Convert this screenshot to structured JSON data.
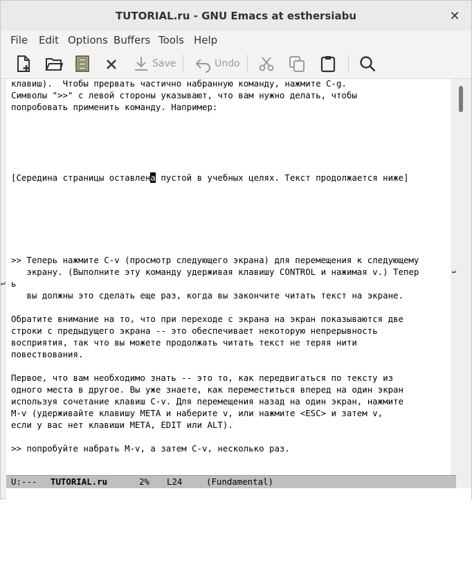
{
  "window": {
    "title": "TUTORIAL.ru - GNU Emacs at esthersiabu",
    "close_glyph": "✕"
  },
  "menubar": [
    "File",
    "Edit",
    "Options",
    "Buffers",
    "Tools",
    "Help"
  ],
  "toolbar": {
    "save_label": "Save",
    "undo_label": "Undo"
  },
  "buffer": {
    "lines": [
      "клавиш).  Чтобы прервать частично набранную команду, нажмите C-g.",
      "Символы \">>\" с левой стороны указывают, что вам нужно делать, чтобы",
      "попробовать применить команду. Например:",
      "",
      "",
      "",
      "",
      "",
      "[Середина страницы оставлен",
      "",
      "",
      "",
      "",
      "",
      "",
      ">> Теперь нажмите C-v (просмотр следующего экрана) для перемещения к следующему",
      "   экрану. (Выполните эту команду удерживая клавишу CONTROL и нажимая v.) Тепер",
      "ь",
      "   вы должны это сделать еще раз, когда вы закончите читать текст на экране.",
      "",
      "Обратите внимание на то, что при переходе с экрана на экран показываются две",
      "строки с предыдущего экрана -- это обеспечивает некоторую непрерывность",
      "восприятия, так что вы можете продолжать читать текст не теряя нити",
      "повествования.",
      "",
      "Первое, что вам необходимо знать -- это то, как передвигаться по тексту из",
      "одного места в другое. Вы уже знаете, как переместиться вперед на один экран",
      "используя сочетание клавиш C-v. Для перемещения назад на один экран, нажмите",
      "M-v (удерживайте клавишу META и наберите v, или нажмите <ESC> и затем v,",
      "если у вас нет клавиши META, EDIT или ALT).",
      "",
      ">> попробуйте набрать M-v, а затем C-v, несколько раз."
    ],
    "cursor_line_before": "[Середина страницы оставлен",
    "cursor_char": "а",
    "cursor_line_after": " пустой в учебных целях. Текст продолжается ниже]",
    "wrap_glyph": "↵"
  },
  "modeline": {
    "status": "U:---",
    "buffer_name": "TUTORIAL.ru",
    "percent": "2%",
    "line": "L24",
    "mode": "(Fundamental)"
  }
}
